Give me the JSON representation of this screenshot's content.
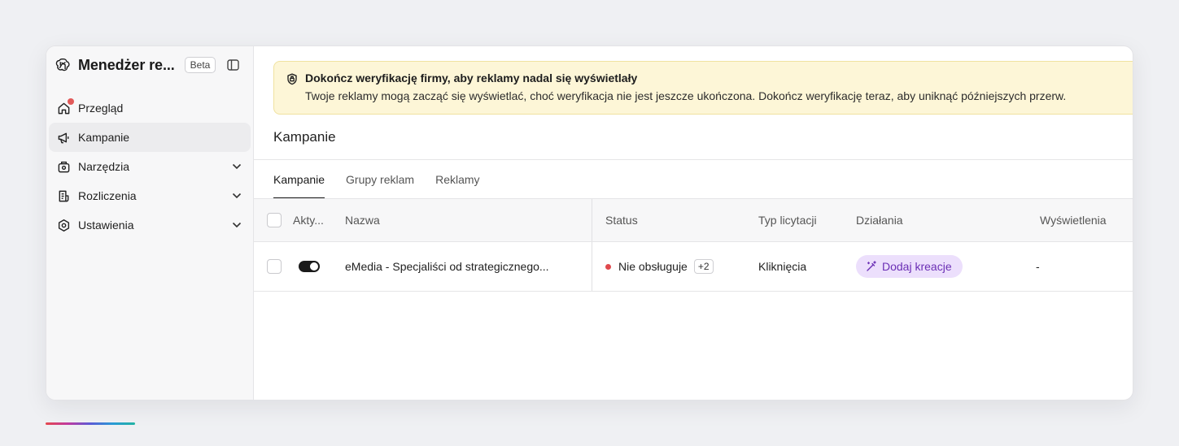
{
  "app": {
    "title": "Menedżer re...",
    "beta_label": "Beta"
  },
  "sidebar": {
    "items": [
      {
        "label": "Przegląd",
        "icon": "home-icon",
        "notification": true
      },
      {
        "label": "Kampanie",
        "icon": "megaphone-icon",
        "active": true
      },
      {
        "label": "Narzędzia",
        "icon": "tools-icon",
        "expandable": true
      },
      {
        "label": "Rozliczenia",
        "icon": "billing-icon",
        "expandable": true
      },
      {
        "label": "Ustawienia",
        "icon": "settings-icon",
        "expandable": true
      }
    ]
  },
  "banner": {
    "title": "Dokończ weryfikację firmy, aby reklamy nadal się wyświetlały",
    "body": "Twoje reklamy mogą zacząć się wyświetlać, choć weryfikacja nie jest jeszcze ukończona. Dokończ weryfikację teraz, aby uniknąć późniejszych przerw."
  },
  "page": {
    "title": "Kampanie"
  },
  "tabs": [
    {
      "label": "Kampanie",
      "active": true
    },
    {
      "label": "Grupy reklam"
    },
    {
      "label": "Reklamy"
    }
  ],
  "table": {
    "columns": {
      "active": "Akty...",
      "name": "Nazwa",
      "status": "Status",
      "bid_type": "Typ licytacji",
      "actions": "Działania",
      "impressions": "Wyświetlenia"
    },
    "rows": [
      {
        "active": true,
        "name": "eMedia - Specjaliści od strategicznego...",
        "status": "Nie obsługuje",
        "status_extra": "+2",
        "bid_type": "Kliknięcia",
        "action": "Dodaj kreacje",
        "impressions": "-"
      }
    ]
  },
  "colors": {
    "banner_bg": "#fdf6d7",
    "status_error": "#e0494d",
    "action_pill_bg": "#ecdffc",
    "action_pill_text": "#6b2fb5"
  }
}
